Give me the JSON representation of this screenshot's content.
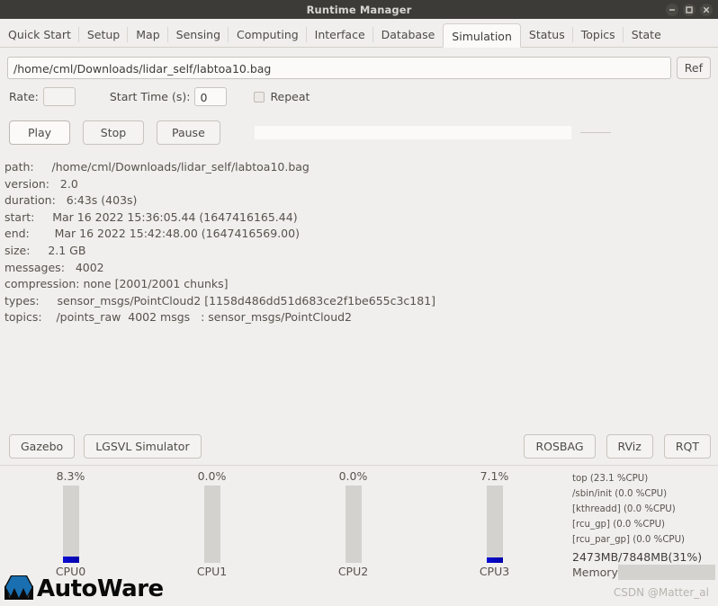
{
  "window": {
    "title": "Runtime Manager",
    "controls": [
      {
        "name": "minimize-button",
        "glyph": "minimize-icon"
      },
      {
        "name": "maximize-button",
        "glyph": "maximize-icon"
      },
      {
        "name": "close-button",
        "glyph": "close-icon"
      }
    ]
  },
  "tabs": [
    {
      "label": "Quick Start",
      "active": false
    },
    {
      "label": "Setup",
      "active": false
    },
    {
      "label": "Map",
      "active": false
    },
    {
      "label": "Sensing",
      "active": false
    },
    {
      "label": "Computing",
      "active": false
    },
    {
      "label": "Interface",
      "active": false
    },
    {
      "label": "Database",
      "active": false
    },
    {
      "label": "Simulation",
      "active": true
    },
    {
      "label": "Status",
      "active": false
    },
    {
      "label": "Topics",
      "active": false
    },
    {
      "label": "State",
      "active": false
    }
  ],
  "simulation": {
    "path_value": "/home/cml/Downloads/lidar_self/labtoa10.bag",
    "path_placeholder": "",
    "ref_label": "Ref",
    "rate_label": "Rate:",
    "rate_value": "",
    "start_time_label": "Start Time (s):",
    "start_time_value": "0",
    "repeat_label": "Repeat",
    "repeat_checked": false,
    "play_label": "Play",
    "stop_label": "Stop",
    "pause_label": "Pause",
    "progress_percent": 0
  },
  "baginfo": {
    "lines": [
      "path:     /home/cml/Downloads/lidar_self/labtoa10.bag",
      "version:   2.0",
      "duration:   6:43s (403s)",
      "start:     Mar 16 2022 15:36:05.44 (1647416165.44)",
      "end:       Mar 16 2022 15:42:48.00 (1647416569.00)",
      "size:     2.1 GB",
      "messages:   4002",
      "compression: none [2001/2001 chunks]",
      "types:     sensor_msgs/PointCloud2 [1158d486dd51d683ce2f1be655c3c181]",
      "topics:    /points_raw  4002 msgs   : sensor_msgs/PointCloud2"
    ]
  },
  "bottom_buttons": {
    "left": [
      {
        "label": "Gazebo",
        "name": "gazebo-button"
      },
      {
        "label": "LGSVL Simulator",
        "name": "lgsvl-simulator-button"
      }
    ],
    "right": [
      {
        "label": "ROSBAG",
        "name": "rosbag-button"
      },
      {
        "label": "RViz",
        "name": "rviz-button"
      },
      {
        "label": "RQT",
        "name": "rqt-button"
      }
    ]
  },
  "monitor": {
    "cpus": [
      {
        "label": "CPU0",
        "percent_text": "8.3%",
        "percent": 8.3
      },
      {
        "label": "CPU1",
        "percent_text": "0.0%",
        "percent": 0.0
      },
      {
        "label": "CPU2",
        "percent_text": "0.0%",
        "percent": 0.0
      },
      {
        "label": "CPU3",
        "percent_text": "7.1%",
        "percent": 7.1
      }
    ],
    "processes": [
      "top (23.1 %CPU)",
      "/sbin/init (0.0 %CPU)",
      "[kthreadd] (0.0 %CPU)",
      "[rcu_gp] (0.0 %CPU)",
      "[rcu_par_gp] (0.0 %CPU)"
    ],
    "memory_text": "2473MB/7848MB(31%)",
    "memory_label": "Memory",
    "memory_percent": 31
  },
  "footer": {
    "logo_text": "AutoWare",
    "watermark": "CSDN @Matter_al"
  },
  "colors": {
    "accent_blue": "#0000a8",
    "window_bg": "#f0efed",
    "titlebar": "#3c3b37"
  }
}
